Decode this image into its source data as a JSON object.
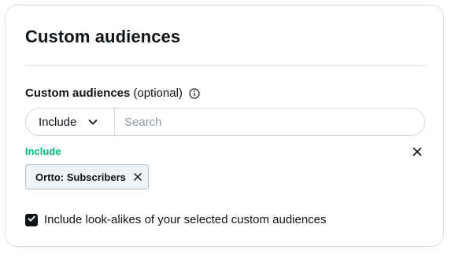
{
  "card": {
    "title": "Custom audiences"
  },
  "field": {
    "label": "Custom audiences",
    "optional": "(optional)",
    "info_icon": "info-circle-icon"
  },
  "search_row": {
    "mode_selected": "Include",
    "chevron_icon": "chevron-down-icon",
    "search_placeholder": "Search",
    "search_value": ""
  },
  "included": {
    "heading": "Include",
    "heading_color": "#00ba7c",
    "clear_icon": "close-icon",
    "chips": [
      {
        "label": "Ortto: Subscribers",
        "remove_icon": "close-icon"
      }
    ]
  },
  "lookalikes": {
    "checked": true,
    "label": "Include look-alikes of your selected custom audiences",
    "check_icon": "checkmark-icon"
  }
}
